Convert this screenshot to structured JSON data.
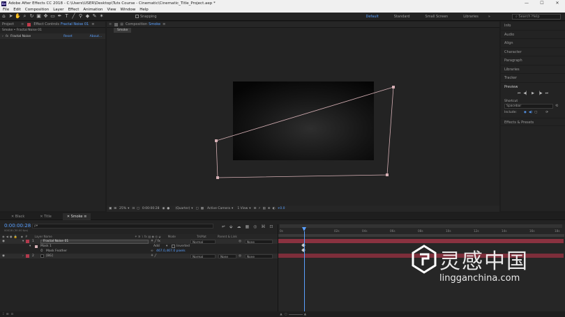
{
  "titlebar": {
    "title": "Adobe After Effects CC 2018 - C:\\Users\\USER\\Desktop\\Tuts Course - Cinematic\\Cinematic_Title_Project.aep *",
    "app_icon": "Ae"
  },
  "menu": [
    "File",
    "Edit",
    "Composition",
    "Layer",
    "Effect",
    "Animation",
    "View",
    "Window",
    "Help"
  ],
  "toolbar": {
    "snapping_label": "Snapping",
    "workspaces": [
      "Default",
      "Standard",
      "Small Screen",
      "Libraries"
    ],
    "workspace_more": "»",
    "search_placeholder": "Search Help"
  },
  "left_panel": {
    "tab_project": "Project",
    "tab_effect_controls": "Effect Controls",
    "tab_effect_name": "Fractal Noise 01",
    "breadcrumb": "Smoke • Fractal Noise 01",
    "fx_label": "fx",
    "effect_name": "Fractal Noise",
    "reset": "Reset",
    "about": "About..."
  },
  "comp_panel": {
    "tab_label": "Composition",
    "tab_name": "Smoke",
    "sub_tab": "Smoke",
    "zoom": "25%",
    "timecode": "0:00:00:28",
    "resolution": "(Quarter)",
    "camera": "Active Camera",
    "views": "1 View",
    "exposure": "+0.0"
  },
  "right_panel": {
    "items": [
      "Info",
      "Audio",
      "Align",
      "Character",
      "Paragraph",
      "Libraries",
      "Tracker"
    ],
    "preview_title": "Preview",
    "shortcut_label": "Shortcut",
    "shortcut_value": "Spacebar",
    "include_label": "Include:",
    "effects_presets": "Effects & Presets"
  },
  "timeline": {
    "tabs": [
      "Black",
      "Title",
      "Smoke"
    ],
    "active_tab": "Smoke",
    "timecode": "0:00:00:28",
    "timecode_sub": "00028 (30.00 fps)",
    "search_placeholder": "ρ▾",
    "columns": {
      "layer_name": "Layer Name",
      "mode": "Mode",
      "trkmat": "TrkMat",
      "parent": "Parent & Link"
    },
    "layers": [
      {
        "num": "1",
        "name": "Fractal Noise 01",
        "mode": "Normal",
        "parent": "None",
        "color": "#b33a4d"
      },
      {
        "num": "",
        "name": "Mask 1",
        "mode": "Add",
        "extra": "Inverted",
        "parent": "",
        "color": ""
      },
      {
        "num": "",
        "name": "Mask Feather",
        "value": "467.0,467.0 pixels",
        "parent": "",
        "color": ""
      },
      {
        "num": "2",
        "name": "[BG]",
        "mode": "Normal",
        "trkmat": "None",
        "parent": "None",
        "color": "#b33a4d"
      }
    ],
    "ruler_labels": [
      "0s",
      "02s",
      "04s",
      "06s",
      "08s",
      "10s",
      "12s",
      "14s",
      "16s",
      "18s",
      "20s"
    ],
    "track_color": "#8a3240"
  },
  "watermark": {
    "cn": "灵感中国",
    "url": "lingganchina.com"
  }
}
